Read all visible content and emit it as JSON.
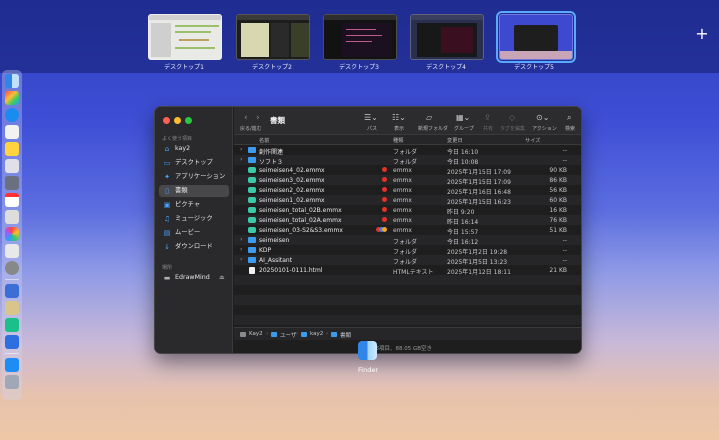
{
  "spaces": [
    {
      "label": "デスクトップ1"
    },
    {
      "label": "デスクトップ2"
    },
    {
      "label": "デスクトップ3"
    },
    {
      "label": "デスクトップ4"
    },
    {
      "label": "デスクトップ5"
    }
  ],
  "add_space_label": "+",
  "finder": {
    "title": "書類",
    "back_forward_label": "戻る/進む",
    "toolbar": {
      "path": "パス",
      "view": "表示",
      "new_folder": "新規フォルダ",
      "group": "グループ",
      "share": "共有",
      "tag": "タグを編集",
      "action": "アクション",
      "search": "検索"
    },
    "sidebar": {
      "favorites_header": "よく使う項目",
      "items": [
        {
          "label": "kay2",
          "icon": "home-icon"
        },
        {
          "label": "デスクトップ",
          "icon": "desktop-icon"
        },
        {
          "label": "アプリケーション",
          "icon": "applications-icon"
        },
        {
          "label": "書類",
          "icon": "document-icon"
        },
        {
          "label": "ピクチャ",
          "icon": "pictures-icon"
        },
        {
          "label": "ミュージック",
          "icon": "music-icon"
        },
        {
          "label": "ムービー",
          "icon": "movies-icon"
        },
        {
          "label": "ダウンロード",
          "icon": "download-icon"
        }
      ],
      "locations_header": "場所",
      "locations": [
        {
          "label": "EdrawMind",
          "icon": "drive-icon"
        }
      ]
    },
    "columns": {
      "name": "名前",
      "kind": "種類",
      "date": "変更日",
      "size": "サイズ"
    },
    "files": [
      {
        "name": "創作関連",
        "kind": "フォルダ",
        "date": "今日 16:10",
        "size": "--",
        "type": "folder",
        "tags": []
      },
      {
        "name": "ソフト３",
        "kind": "フォルダ",
        "date": "今日 10:08",
        "size": "--",
        "type": "folder",
        "tags": []
      },
      {
        "name": "seimeisen4_02.emmx",
        "kind": "emmx",
        "date": "2025年1月15日 17:09",
        "size": "90 KB",
        "type": "emmx",
        "tags": [
          "#e0342a"
        ]
      },
      {
        "name": "seimeisen3_02.emmx",
        "kind": "emmx",
        "date": "2025年1月15日 17:09",
        "size": "86 KB",
        "type": "emmx",
        "tags": [
          "#e0342a"
        ]
      },
      {
        "name": "seimeisen2_02.emmx",
        "kind": "emmx",
        "date": "2025年1月16日 16:48",
        "size": "56 KB",
        "type": "emmx",
        "tags": [
          "#e0342a"
        ]
      },
      {
        "name": "seimeisen1_02.emmx",
        "kind": "emmx",
        "date": "2025年1月15日 16:23",
        "size": "60 KB",
        "type": "emmx",
        "tags": [
          "#e0342a"
        ]
      },
      {
        "name": "seimeisen_total_02B.emmx",
        "kind": "emmx",
        "date": "昨日 9:20",
        "size": "16 KB",
        "type": "emmx",
        "tags": [
          "#e0342a"
        ]
      },
      {
        "name": "seimeisen_total_02A.emmx",
        "kind": "emmx",
        "date": "昨日 16:14",
        "size": "76 KB",
        "type": "emmx",
        "tags": [
          "#e0342a"
        ]
      },
      {
        "name": "seimeisen_03-S2&S3.emmx",
        "kind": "emmx",
        "date": "今日 15:57",
        "size": "51 KB",
        "type": "emmx",
        "tags": [
          "#e0342a",
          "#3b82f6",
          "#f5a623"
        ]
      },
      {
        "name": "seimeisen",
        "kind": "フォルダ",
        "date": "今日 16:12",
        "size": "--",
        "type": "folder",
        "tags": []
      },
      {
        "name": "KDP",
        "kind": "フォルダ",
        "date": "2025年1月2日 19:28",
        "size": "--",
        "type": "folder",
        "tags": []
      },
      {
        "name": "AI_Assitant",
        "kind": "フォルダ",
        "date": "2025年1月5日 13:23",
        "size": "--",
        "type": "folder",
        "tags": []
      },
      {
        "name": "20250101-0111.html",
        "kind": "HTMLテキスト",
        "date": "2025年1月12日 18:11",
        "size": "21 KB",
        "type": "html",
        "tags": []
      }
    ],
    "pathbar": [
      "Kay2",
      "ユーザ",
      "kay2",
      "書類"
    ],
    "status": "13項目、88.05 GB空き"
  },
  "dock_app_label": "Finder"
}
